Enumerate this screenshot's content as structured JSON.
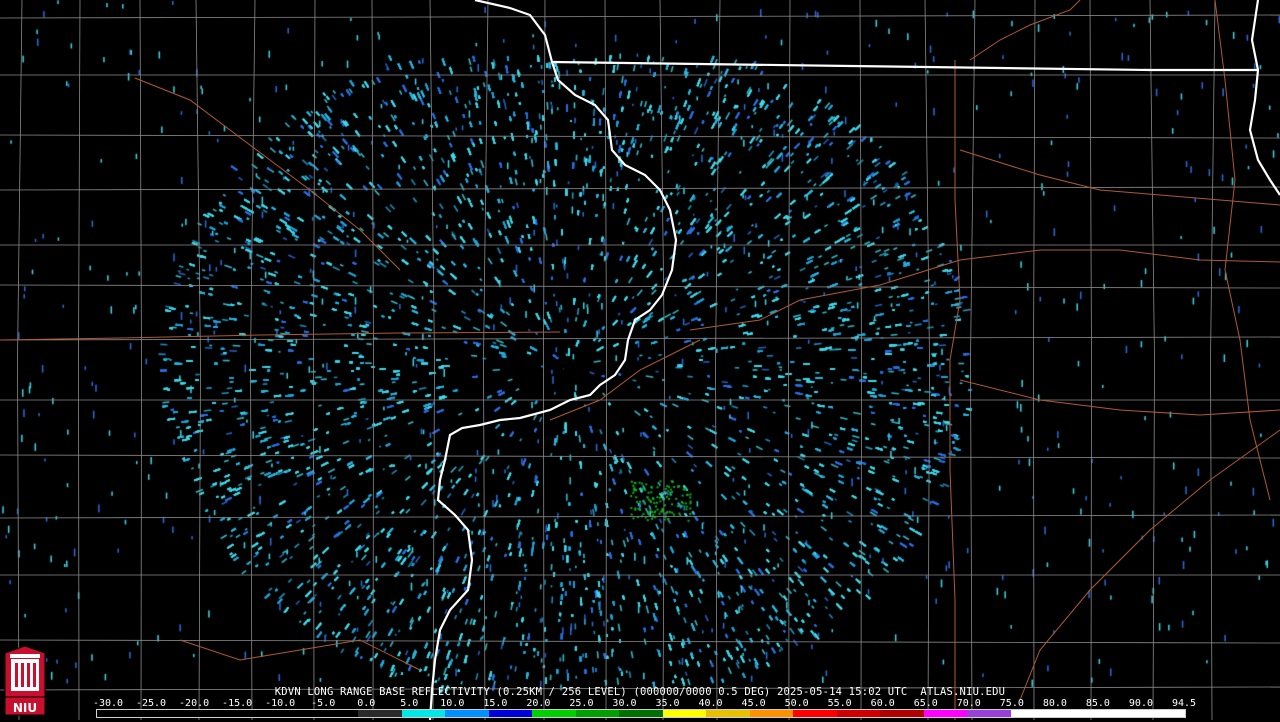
{
  "product_caption": "KDVN LONG RANGE BASE REFLECTIVITY (0.25KM / 256 LEVEL) (000000/0000 0.5 DEG) 2025-05-14 15:02 UTC  ATLAS.NIU.EDU",
  "legend": {
    "tick_labels": [
      "-30.0",
      "-25.0",
      "-20.0",
      "-15.0",
      "-10.0",
      "-5.0",
      "0.0",
      "5.0",
      "10.0",
      "15.0",
      "20.0",
      "25.0",
      "30.0",
      "35.0",
      "40.0",
      "45.0",
      "50.0",
      "55.0",
      "60.0",
      "65.0",
      "70.0",
      "75.0",
      "80.0",
      "85.0",
      "90.0",
      "94.5"
    ],
    "colors": [
      "#000000",
      "#000000",
      "#000000",
      "#000000",
      "#000000",
      "#000000",
      "#2a2a2a",
      "#00e8e8",
      "#0090ff",
      "#0000d8",
      "#00d000",
      "#00a000",
      "#007000",
      "#ffff00",
      "#e8c000",
      "#ff9000",
      "#ff0000",
      "#d00000",
      "#b00000",
      "#ff00ff",
      "#9a40d8",
      "#ffffff",
      "#ffffff",
      "#ffffff",
      "#ffffff"
    ]
  },
  "logo": {
    "text": "NIU",
    "colors": {
      "background": "#c8102e",
      "emblem": "#ffffff",
      "frame": "#000000"
    }
  },
  "map_colors": {
    "state_border": "#ffffff",
    "county_lines": "#8a8a8a",
    "highways": "#b05a32",
    "background": "#000000",
    "echo_cyan": "#3fd8e8",
    "echo_blue": "#2a6ee0",
    "echo_green": "#10b020"
  }
}
